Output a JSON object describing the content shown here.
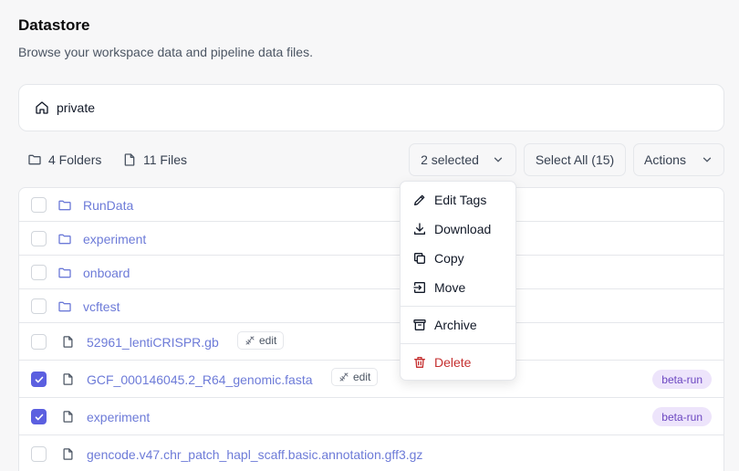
{
  "header": {
    "title": "Datastore",
    "subtitle": "Browse your workspace data and pipeline data files."
  },
  "breadcrumb": {
    "icon": "home-icon",
    "label": "private"
  },
  "summary": {
    "folders_label": "4 Folders",
    "files_label": "11 Files"
  },
  "toolbar": {
    "selected_label": "2 selected",
    "select_all_label": "Select All (15)",
    "actions_label": "Actions"
  },
  "rows": [
    {
      "type": "folder",
      "name": "RunData",
      "checked": false
    },
    {
      "type": "folder",
      "name": "experiment",
      "checked": false
    },
    {
      "type": "folder",
      "name": "onboard",
      "checked": false
    },
    {
      "type": "folder",
      "name": "vcftest",
      "checked": false
    },
    {
      "type": "file",
      "name": "52961_lentiCRISPR.gb",
      "checked": false,
      "edit_label": "edit"
    },
    {
      "type": "file",
      "name": "GCF_000146045.2_R64_genomic.fasta",
      "checked": true,
      "edit_label": "edit",
      "tag": "beta-run"
    },
    {
      "type": "file",
      "name": "experiment",
      "checked": true,
      "tag": "beta-run"
    },
    {
      "type": "file",
      "name": "gencode.v47.chr_patch_hapl_scaff.basic.annotation.gff3.gz",
      "checked": false
    }
  ],
  "menu": {
    "edit_tags": "Edit Tags",
    "download": "Download",
    "copy": "Copy",
    "move": "Move",
    "archive": "Archive",
    "delete": "Delete"
  },
  "colors": {
    "accent": "#5b5fe0",
    "link": "#6d7bd8",
    "tag_bg": "#ede4fb",
    "tag_text": "#6b46c1",
    "danger": "#c53030"
  }
}
